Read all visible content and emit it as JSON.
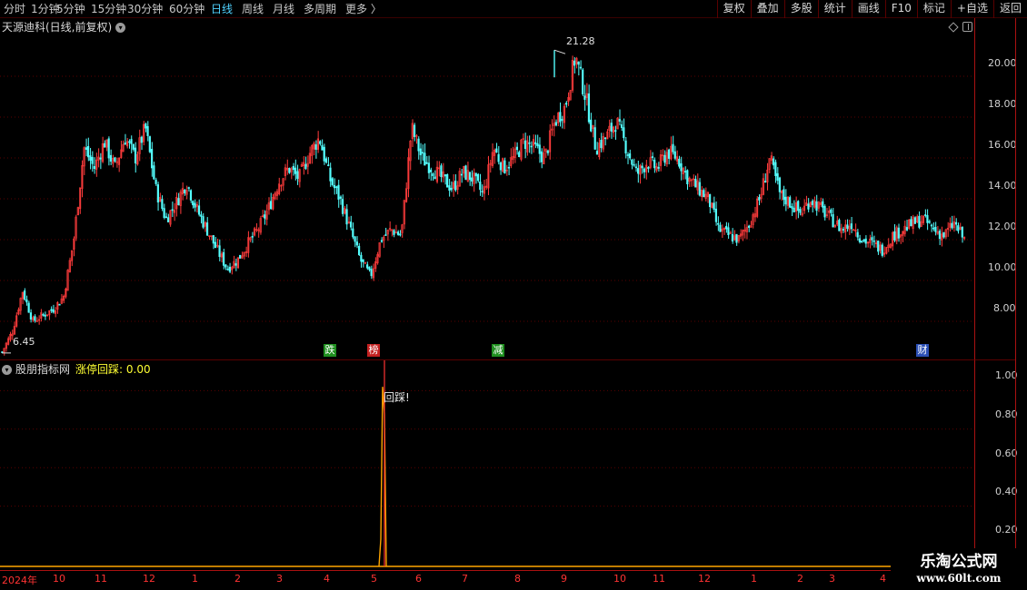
{
  "toolbar": {
    "periods": [
      "分时",
      "1分钟",
      "5分钟",
      "15分钟",
      "30分钟",
      "60分钟",
      "日线",
      "周线",
      "月线",
      "多周期",
      "更多 〉"
    ],
    "active_period": "日线",
    "buttons": [
      "复权",
      "叠加",
      "多股",
      "统计",
      "画线",
      "F10",
      "标记",
      "+自选",
      "返回"
    ]
  },
  "main": {
    "title": "天源迪科(日线,前复权)",
    "high_label": "21.28",
    "low_label": "6.45",
    "events": [
      {
        "text": "跌",
        "color": "#1f8f1f"
      },
      {
        "text": "榜",
        "color": "#c42020"
      },
      {
        "text": "减",
        "color": "#1f8f1f"
      },
      {
        "text": "财",
        "color": "#2b4fb5"
      }
    ]
  },
  "indicator": {
    "name": "股朋指标网",
    "value_label": "涨停回踩: 0.00",
    "signal_label": "回踩!"
  },
  "axes": {
    "price_ticks": [
      "20.00",
      "18.00",
      "16.00",
      "14.00",
      "12.00",
      "10.00",
      "8.00"
    ],
    "indicator_ticks": [
      "1.00",
      "0.80",
      "0.60",
      "0.40",
      "0.20"
    ],
    "dates": [
      "2024年",
      "10",
      "11",
      "12",
      "1",
      "2",
      "3",
      "4",
      "5",
      "6",
      "7",
      "8",
      "9",
      "10",
      "11",
      "12",
      "1",
      "2",
      "3",
      "4"
    ]
  },
  "colors": {
    "up": "#ff3c3c",
    "down": "#54ffff",
    "axis": "#aa1111",
    "signal": "#ffa500"
  },
  "watermark": {
    "title": "乐淘公式网",
    "url": "www.60lt.com"
  },
  "chart_data": {
    "type": "candlestick",
    "title": "天源迪科(日线,前复权)",
    "y_range": [
      6.45,
      21.28
    ],
    "y_ticks": [
      8,
      10,
      12,
      14,
      16,
      18,
      20
    ],
    "max_price": 21.28,
    "min_price": 6.45,
    "x_ticks": [
      "2024年",
      "10",
      "11",
      "12",
      "1",
      "2",
      "3",
      "4",
      "5",
      "6",
      "7",
      "8",
      "9",
      "10",
      "11",
      "12",
      "1",
      "2",
      "3",
      "4"
    ],
    "close_path": [
      6.5,
      7.5,
      9.5,
      8.0,
      8.3,
      8.6,
      9.2,
      12.0,
      16.5,
      15.5,
      16.8,
      15.5,
      17.0,
      16.0,
      17.5,
      14.5,
      13.0,
      13.8,
      14.8,
      13.5,
      12.5,
      11.5,
      10.6,
      11.0,
      11.8,
      12.5,
      13.5,
      14.8,
      15.5,
      15.0,
      16.2,
      17.0,
      15.0,
      14.0,
      12.5,
      11.0,
      10.2,
      12.0,
      12.5,
      12.2,
      17.5,
      16.0,
      15.5,
      15.0,
      14.5,
      15.3,
      15.0,
      14.2,
      16.5,
      15.5,
      16.0,
      16.8,
      16.5,
      16.0,
      17.8,
      18.5,
      21.0,
      19.0,
      16.5,
      17.0,
      17.8,
      16.5,
      15.2,
      15.8,
      15.5,
      16.3,
      16.0,
      15.0,
      14.5,
      14.0,
      12.5,
      12.2,
      12.0,
      12.8,
      14.0,
      16.0,
      14.2,
      13.8,
      13.3,
      14.0,
      13.5,
      13.0,
      12.5,
      12.8,
      12.0,
      11.8,
      11.5,
      12.2,
      12.5,
      12.8,
      13.0,
      12.5,
      12.2,
      12.8,
      12.0
    ],
    "indicator": {
      "name": "涨停回踩",
      "value": 0.0,
      "y_range": [
        0,
        1.0
      ],
      "spike_value": 0.82,
      "spike_month": "5"
    }
  }
}
